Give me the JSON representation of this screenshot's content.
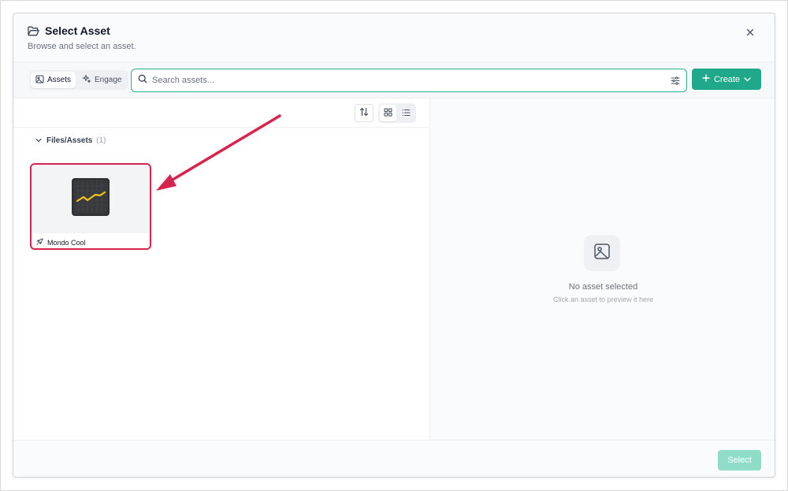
{
  "dialog": {
    "title": "Select Asset",
    "subtitle": "Browse and select an asset.",
    "icons": {
      "title": "folder-open-icon",
      "close": "close-icon"
    }
  },
  "toolbar": {
    "tabs": [
      {
        "label": "Assets",
        "icon": "image-icon",
        "active": true
      },
      {
        "label": "Engage",
        "icon": "sparkles-icon",
        "active": false
      }
    ],
    "search": {
      "placeholder": "Search assets...",
      "value": ""
    },
    "create_label": "Create"
  },
  "browser": {
    "folder": {
      "name": "Files/Assets",
      "count": "(1)"
    },
    "assets": [
      {
        "name": "Mondo Cool",
        "type_icon": "rocket-icon",
        "thumbnail_icon": "activity-monitor-icon",
        "highlighted": true
      }
    ],
    "view_mode": "grid"
  },
  "preview": {
    "empty_title": "No asset selected",
    "empty_subtitle": "Click an asset to preview it here"
  },
  "footer": {
    "select_label": "Select"
  },
  "colors": {
    "accent": "#1fa88a",
    "accent_disabled": "#8fdcc9",
    "highlight": "#d6244c"
  }
}
